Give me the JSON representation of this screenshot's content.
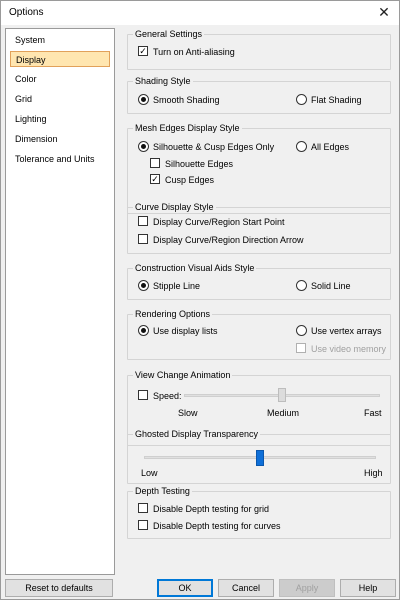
{
  "window": {
    "title": "Options",
    "close_glyph": "✕"
  },
  "sidebar": {
    "items": [
      {
        "label": "System",
        "selected": false
      },
      {
        "label": "Display",
        "selected": true
      },
      {
        "label": "Color",
        "selected": false
      },
      {
        "label": "Grid",
        "selected": false
      },
      {
        "label": "Lighting",
        "selected": false
      },
      {
        "label": "Dimension",
        "selected": false
      },
      {
        "label": "Tolerance  and Units",
        "selected": false
      }
    ]
  },
  "general": {
    "title": "General Settings",
    "anti_aliasing": {
      "label": "Turn on Anti-aliasing",
      "checked": true
    }
  },
  "shading": {
    "title": "Shading Style",
    "smooth": {
      "label": "Smooth Shading",
      "selected": true
    },
    "flat": {
      "label": "Flat Shading",
      "selected": false
    }
  },
  "mesh_edges": {
    "title": "Mesh Edges Display Style",
    "silhouette_cusp": {
      "label": "Silhouette & Cusp Edges Only",
      "selected": true
    },
    "all_edges": {
      "label": "All Edges",
      "selected": false
    },
    "silhouette_edges": {
      "label": "Silhouette Edges",
      "checked": false
    },
    "cusp_edges": {
      "label": "Cusp Edges",
      "checked": true
    }
  },
  "curve_display": {
    "title": "Curve Display Style",
    "start_point": {
      "label": "Display Curve/Region Start Point",
      "checked": false
    },
    "direction_arrow": {
      "label": "Display Curve/Region Direction Arrow",
      "checked": false
    }
  },
  "construction": {
    "title": "Construction Visual Aids Style",
    "stipple": {
      "label": "Stipple Line",
      "selected": true
    },
    "solid": {
      "label": "Solid Line",
      "selected": false
    }
  },
  "rendering": {
    "title": "Rendering Options",
    "display_lists": {
      "label": "Use display lists",
      "selected": true
    },
    "vertex_arrays": {
      "label": "Use vertex arrays",
      "selected": false
    },
    "video_memory": {
      "label": "Use video memory",
      "checked": false,
      "enabled": false
    }
  },
  "view_animation": {
    "title": "View Change Animation",
    "speed": {
      "label": "Speed:",
      "checked": false
    },
    "slider_value": 0.5,
    "ticks": {
      "slow": "Slow",
      "medium": "Medium",
      "fast": "Fast"
    }
  },
  "ghosted": {
    "title": "Ghosted Display Transparency",
    "slider_value": 0.5,
    "ticks": {
      "low": "Low",
      "high": "High"
    }
  },
  "depth": {
    "title": "Depth Testing",
    "grid": {
      "label": "Disable Depth testing for grid",
      "checked": false
    },
    "curves": {
      "label": "Disable Depth testing for curves",
      "checked": false
    }
  },
  "buttons": {
    "reset": "Reset to defaults",
    "ok": "OK",
    "cancel": "Cancel",
    "apply": "Apply",
    "help": "Help"
  },
  "colors": {
    "selected_item_bg": "#ffe6b0",
    "selected_item_border": "#e1a15a",
    "slider_thumb_active": "#0e6fd8",
    "default_button_border": "#0078d7"
  }
}
